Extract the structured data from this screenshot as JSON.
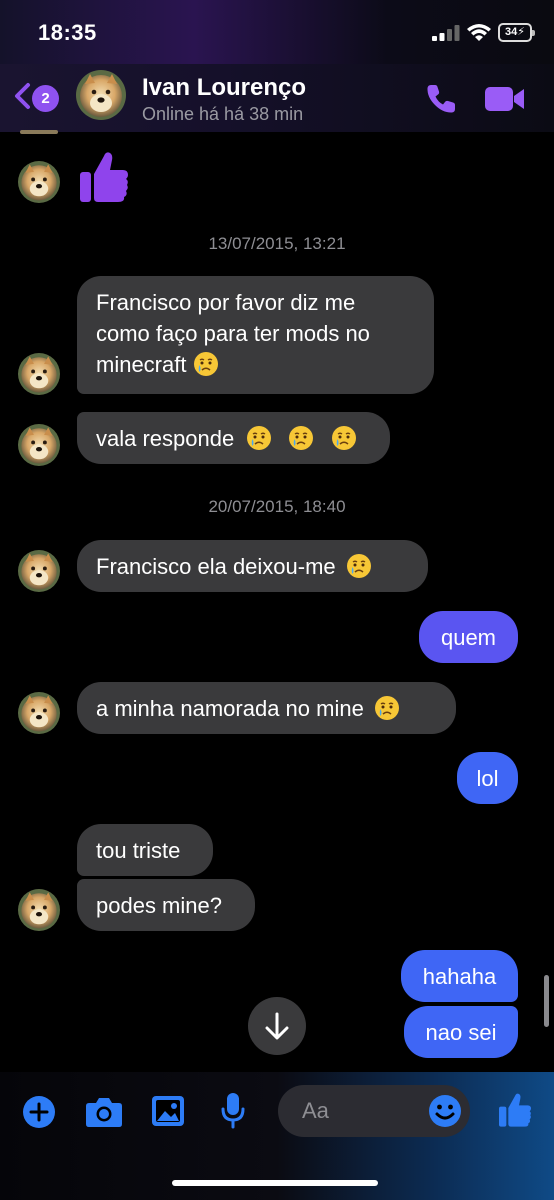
{
  "status_bar": {
    "time": "18:35",
    "battery": "34"
  },
  "header": {
    "unread_count": "2",
    "contact_name": "Ivan Lourenço",
    "presence": "Online há há 38 min"
  },
  "messages": {
    "date_1": "13/07/2015, 13:21",
    "m1_line1": "Francisco por favor diz me",
    "m1_line2": "como faço para ter mods no",
    "m1_line3": "minecraft",
    "m2": "vala responde",
    "date_2": "20/07/2015, 18:40",
    "m3": "Francisco ela deixou-me",
    "m4": "quem",
    "m5": "a minha namorada no mine",
    "m6": "lol",
    "m7": "tou triste",
    "m8": "podes mine?",
    "m9": "hahaha",
    "m10": "nao sei"
  },
  "composer": {
    "placeholder": "Aa"
  },
  "colors": {
    "accent": "#8f52f0",
    "outgoing_bubble": "#3f66f5",
    "incoming_bubble": "#3a3a3c",
    "composer_icon": "#2d7cf6"
  },
  "icons": [
    "back-chevron-icon",
    "phone-icon",
    "video-camera-icon",
    "thumbs-up-icon",
    "crying-emoji-icon",
    "arrow-down-icon",
    "plus-icon",
    "camera-icon",
    "image-icon",
    "microphone-icon",
    "smiley-icon"
  ]
}
